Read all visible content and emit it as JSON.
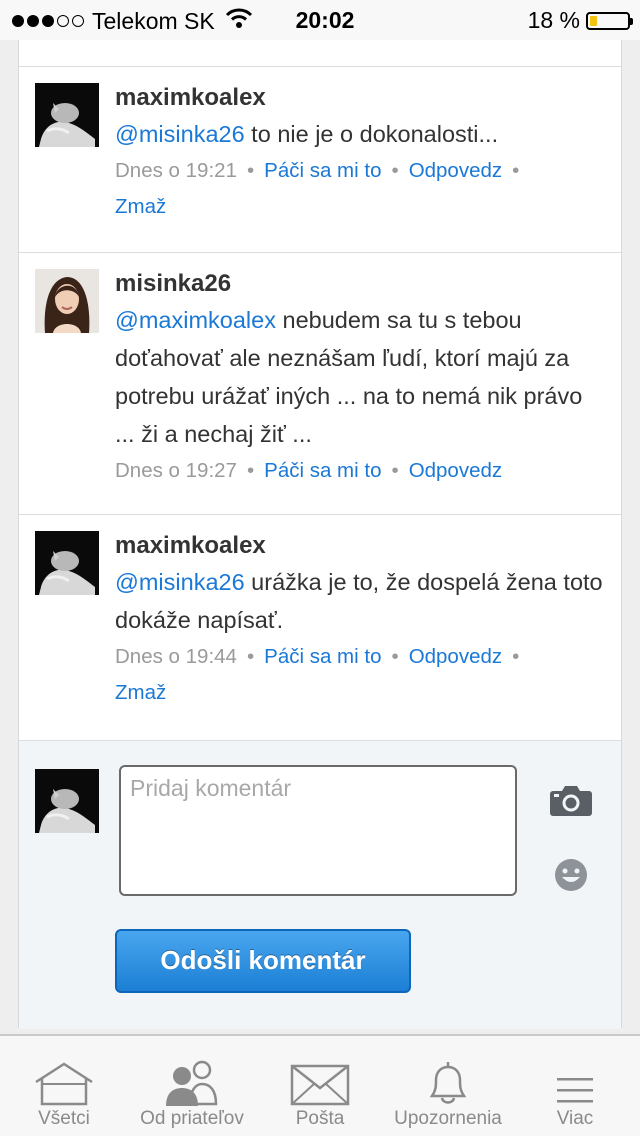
{
  "status_bar": {
    "carrier": "Telekom SK",
    "time": "20:02",
    "battery": "18 %",
    "battery_level": 0.18,
    "signal_bars": 3
  },
  "comments": [
    {
      "author": "maximkoalex",
      "mention": "@misinka26",
      "text": " to nie je o dokonalosti...",
      "time": "Dnes o 19:21",
      "like": "Páči sa mi to",
      "reply": "Odpovedz",
      "delete": "Zmaž",
      "avatar": "cat-photo"
    },
    {
      "author": "misinka26",
      "mention": "@maximkoalex",
      "text": " nebudem sa tu s tebou doťahovať ale neznášam ľudí, ktorí majú za potrebu urážať iných ... na to nemá nik právo ... ži a nechaj žiť ...",
      "time": "Dnes o 19:27",
      "like": "Páči sa mi to",
      "reply": "Odpovedz",
      "avatar": "woman-photo"
    },
    {
      "author": "maximkoalex",
      "mention": "@misinka26",
      "text": " urážka je to, že dospelá žena toto dokáže napísať.",
      "time": "Dnes o 19:44",
      "like": "Páči sa mi to",
      "reply": "Odpovedz",
      "delete": "Zmaž",
      "avatar": "cat-photo"
    }
  ],
  "comment_form": {
    "placeholder": "Pridaj komentár",
    "submit": "Odošli komentár",
    "icons": [
      "camera-icon",
      "smiley-icon"
    ]
  },
  "tabs": [
    {
      "label": "Všetci",
      "icon": "house-icon"
    },
    {
      "label": "Od priateľov",
      "icon": "friends-icon"
    },
    {
      "label": "Pošta",
      "icon": "envelope-icon"
    },
    {
      "label": "Upozornenia",
      "icon": "bell-icon"
    },
    {
      "label": "Viac",
      "icon": "menu-icon"
    }
  ],
  "colors": {
    "link": "#1a78d6",
    "button": "#1c7fd5",
    "form_background": "#f2f5f7",
    "battery": "#f2c40f"
  }
}
